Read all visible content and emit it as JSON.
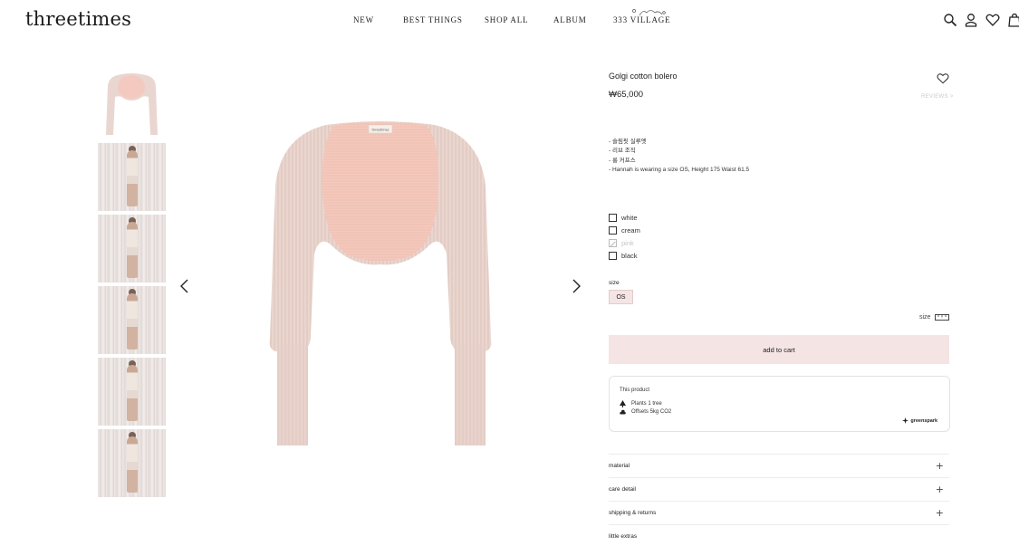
{
  "header": {
    "logo": "threetimes",
    "nav": [
      {
        "label": "NEW"
      },
      {
        "label": "BEST THINGS"
      },
      {
        "label": "SHOP ALL"
      },
      {
        "label": "ALBUM"
      },
      {
        "label": "333 VILLAGE"
      }
    ],
    "icons": [
      "search-icon",
      "account-icon",
      "wishlist-icon",
      "cart-icon"
    ]
  },
  "gallery": {
    "thumbnail_count": 6,
    "prev_icon": "chevron-left-icon",
    "next_icon": "chevron-right-icon",
    "main_image": "pink-knit-bolero",
    "garment_label": "threetimes"
  },
  "product": {
    "title": "Golgi cotton bolero",
    "price": "₩65,000",
    "reviews": "REVIEWS >",
    "description": [
      "- 슬림핏 실루엣",
      "- 리브 조직",
      "- 롱 커프스",
      "- Hannah is wearing a size OS, Height 175 Waist 61.5"
    ],
    "colors": [
      {
        "label": "white",
        "available": true
      },
      {
        "label": "cream",
        "available": true
      },
      {
        "label": "pink",
        "available": false
      },
      {
        "label": "black",
        "available": true
      }
    ],
    "size_label": "size",
    "size_option": "OS",
    "size_guide": "size",
    "add_to_cart": "add to cart",
    "accent_color": "#f5e4e4"
  },
  "eco": {
    "title": "This product",
    "plants": "Plants 1 tree",
    "offsets": "Offsets 5kg CO2",
    "brand": "greenspark"
  },
  "accordion": [
    {
      "label": "material"
    },
    {
      "label": "care detail"
    },
    {
      "label": "shipping & returns"
    },
    {
      "label": "little extras"
    }
  ]
}
